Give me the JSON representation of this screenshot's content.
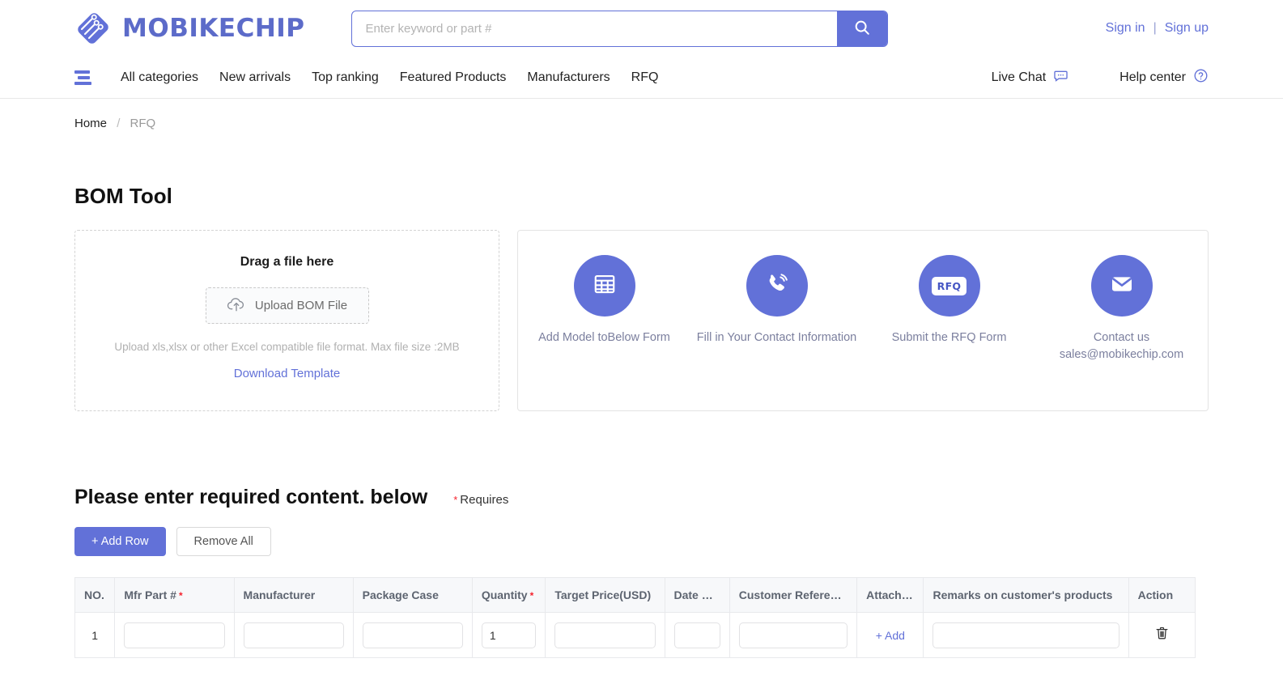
{
  "brand": {
    "name": "MOBIKECHIP",
    "accent": "#6271D8",
    "logo_icon": "circuit-diamond-logo"
  },
  "search": {
    "placeholder": "Enter keyword or part #",
    "value": "",
    "icon": "search-icon"
  },
  "account": {
    "sign_in": "Sign in",
    "separator": "|",
    "sign_up": "Sign up"
  },
  "nav": {
    "menu_icon": "hamburger-menu-icon",
    "items": [
      {
        "label": "All categories"
      },
      {
        "label": "New arrivals"
      },
      {
        "label": "Top ranking"
      },
      {
        "label": "Featured Products"
      },
      {
        "label": "Manufacturers"
      },
      {
        "label": "RFQ"
      }
    ],
    "right": [
      {
        "label": "Live Chat",
        "icon": "chat-bubble-icon"
      },
      {
        "label": "Help center",
        "icon": "question-circle-icon"
      }
    ]
  },
  "breadcrumb": {
    "home": "Home",
    "separator": "/",
    "current": "RFQ"
  },
  "page": {
    "title": "BOM Tool"
  },
  "upload": {
    "drag_title": "Drag a file here",
    "button_label": "Upload BOM File",
    "button_icon": "cloud-upload-icon",
    "hint": "Upload xls,xlsx or other Excel compatible file format. Max file size :2MB",
    "download_template": "Download Template"
  },
  "steps": [
    {
      "icon": "grid-table-icon",
      "label": "Add Model toBelow Form"
    },
    {
      "icon": "phone-ring-icon",
      "label": "Fill in Your Contact Information"
    },
    {
      "icon": "rfq-badge-icon",
      "badge_text": "RFQ",
      "label": "Submit the RFQ Form"
    },
    {
      "icon": "envelope-icon",
      "label": "Contact us",
      "sublabel": "sales@mobikechip.com"
    }
  ],
  "form": {
    "heading": "Please enter required content. below",
    "requires_note": "Requires",
    "requires_asterisk": "*",
    "add_row_label": "+ Add Row",
    "remove_all_label": "Remove All"
  },
  "table": {
    "columns": [
      {
        "label": "NO.",
        "required": false
      },
      {
        "label": "Mfr Part #",
        "required": true
      },
      {
        "label": "Manufacturer",
        "required": false
      },
      {
        "label": "Package Case",
        "required": false
      },
      {
        "label": "Quantity",
        "required": true
      },
      {
        "label": "Target Price(USD)",
        "required": false
      },
      {
        "label": "Date Co...",
        "required": false
      },
      {
        "label": "Customer Reference",
        "required": false
      },
      {
        "label": "Attachment",
        "required": false
      },
      {
        "label": "Remarks on customer's products",
        "required": false
      },
      {
        "label": "Action",
        "required": false
      }
    ],
    "rows": [
      {
        "no": "1",
        "mfr_part": "",
        "manufacturer": "",
        "package_case": "",
        "quantity": "1",
        "target_price": "",
        "date_code": "",
        "customer_reference": "",
        "attachment_label": "+ Add",
        "remarks": "",
        "action_icon": "trash-icon"
      }
    ]
  }
}
